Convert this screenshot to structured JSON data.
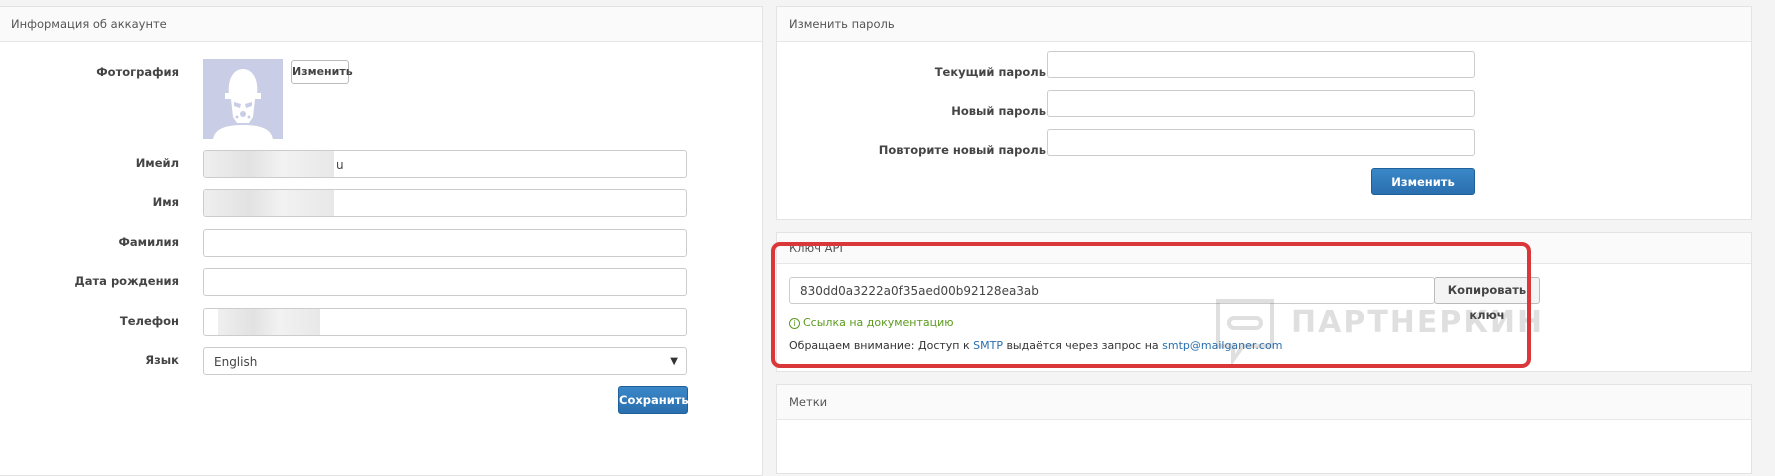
{
  "account": {
    "title": "Информация об аккаунте",
    "photo_label": "Фотография",
    "change_photo_label": "Изменить",
    "email_label": "Имейл",
    "email_value": "u",
    "name_label": "Имя",
    "lastname_label": "Фамилия",
    "birthdate_label": "Дата рождения",
    "phone_label": "Телефон",
    "language_label": "Язык",
    "language_value": "English",
    "save_label": "Сохранить"
  },
  "password": {
    "title": "Изменить пароль",
    "current_label": "Текущий пароль",
    "new_label": "Новый пароль",
    "repeat_label": "Повторите новый пароль",
    "submit_label": "Изменить пароль"
  },
  "api": {
    "title": "Ключ API",
    "key_value": "830dd0a3222a0f35aed00b92128ea3ab",
    "copy_label": "Копировать ключ",
    "doc_link": "Ссылка на документацию",
    "notice_prefix": "Обращаем внимание: Доступ к",
    "notice_smtp": "SMTP",
    "notice_middle": "выдаётся через запрос на",
    "notice_email": "smtp@mailganer.com"
  },
  "tags": {
    "title": "Метки"
  },
  "watermark": {
    "text": "ПАРТНЕРКИН"
  },
  "colors": {
    "primary": "#2a6fae",
    "highlight": "#d9373a",
    "success": "#5a9a1d"
  }
}
